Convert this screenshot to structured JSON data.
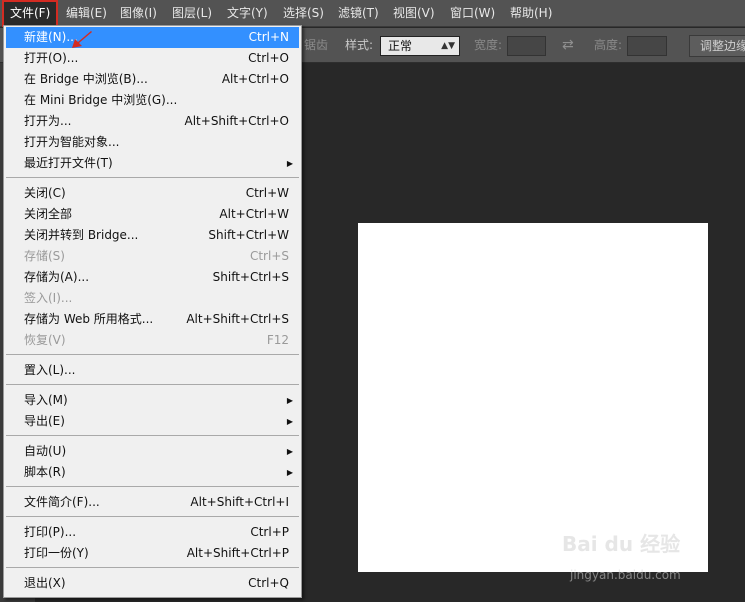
{
  "menubar": {
    "items": [
      {
        "label": "文件(F)",
        "active": true
      },
      {
        "label": "编辑(E)"
      },
      {
        "label": "图像(I)"
      },
      {
        "label": "图层(L)"
      },
      {
        "label": "文字(Y)"
      },
      {
        "label": "选择(S)"
      },
      {
        "label": "滤镜(T)"
      },
      {
        "label": "视图(V)"
      },
      {
        "label": "窗口(W)"
      },
      {
        "label": "帮助(H)"
      }
    ]
  },
  "options": {
    "partial_label": "锯齿",
    "style_label": "样式:",
    "style_value": "正常",
    "width_label": "宽度:",
    "height_label": "高度:",
    "refine_button": "调整边缘"
  },
  "file_menu": {
    "items": [
      {
        "label": "新建(N)...",
        "shortcut": "Ctrl+N",
        "highlighted": true
      },
      {
        "label": "打开(O)...",
        "shortcut": "Ctrl+O"
      },
      {
        "label": "在 Bridge 中浏览(B)...",
        "shortcut": "Alt+Ctrl+O"
      },
      {
        "label": "在 Mini Bridge 中浏览(G)...",
        "shortcut": ""
      },
      {
        "label": "打开为...",
        "shortcut": "Alt+Shift+Ctrl+O"
      },
      {
        "label": "打开为智能对象...",
        "shortcut": ""
      },
      {
        "label": "最近打开文件(T)",
        "shortcut": "",
        "submenu": true
      },
      {
        "label": "关闭(C)",
        "shortcut": "Ctrl+W"
      },
      {
        "label": "关闭全部",
        "shortcut": "Alt+Ctrl+W"
      },
      {
        "label": "关闭并转到 Bridge...",
        "shortcut": "Shift+Ctrl+W"
      },
      {
        "label": "存储(S)",
        "shortcut": "Ctrl+S",
        "disabled": true
      },
      {
        "label": "存储为(A)...",
        "shortcut": "Shift+Ctrl+S"
      },
      {
        "label": "签入(I)...",
        "shortcut": "",
        "disabled": true
      },
      {
        "label": "存储为 Web 所用格式...",
        "shortcut": "Alt+Shift+Ctrl+S"
      },
      {
        "label": "恢复(V)",
        "shortcut": "F12",
        "disabled": true
      },
      {
        "label": "置入(L)...",
        "shortcut": ""
      },
      {
        "label": "导入(M)",
        "shortcut": "",
        "submenu": true
      },
      {
        "label": "导出(E)",
        "shortcut": "",
        "submenu": true
      },
      {
        "label": "自动(U)",
        "shortcut": "",
        "submenu": true
      },
      {
        "label": "脚本(R)",
        "shortcut": "",
        "submenu": true
      },
      {
        "label": "文件简介(F)...",
        "shortcut": "Alt+Shift+Ctrl+I"
      },
      {
        "label": "打印(P)...",
        "shortcut": "Ctrl+P"
      },
      {
        "label": "打印一份(Y)",
        "shortcut": "Alt+Shift+Ctrl+P"
      },
      {
        "label": "退出(X)",
        "shortcut": "Ctrl+Q"
      }
    ],
    "submenu_arrow": "▶"
  },
  "watermark": {
    "brand": "Bai du 经验",
    "url": "jingyan.baidu.com"
  },
  "colors": {
    "accent": "#3390ff",
    "highlight_border": "#d42b22",
    "arrow": "#d42b22"
  }
}
